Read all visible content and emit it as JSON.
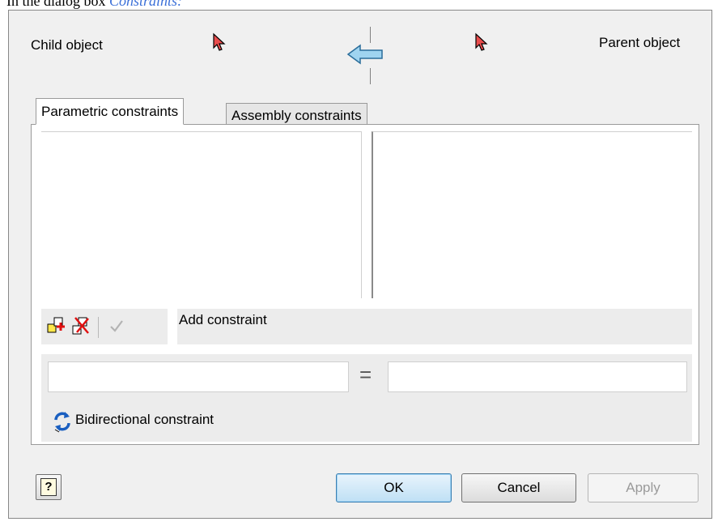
{
  "caption": {
    "prefix": "In the dialog box ",
    "link": "Constraints:"
  },
  "header": {
    "child_label": "Child object",
    "parent_label": "Parent object"
  },
  "tabs": [
    {
      "label": "Parametric constraints",
      "active": true
    },
    {
      "label": "Assembly constraints",
      "active": false
    }
  ],
  "toolbar": {
    "add_constraint_label": "Add constraint"
  },
  "equation": {
    "equals_symbol": "=",
    "left_value": "",
    "right_value": ""
  },
  "bidirectional_label": "Bidirectional constraint",
  "buttons": {
    "help": "?",
    "ok": "OK",
    "cancel": "Cancel",
    "apply": "Apply"
  }
}
